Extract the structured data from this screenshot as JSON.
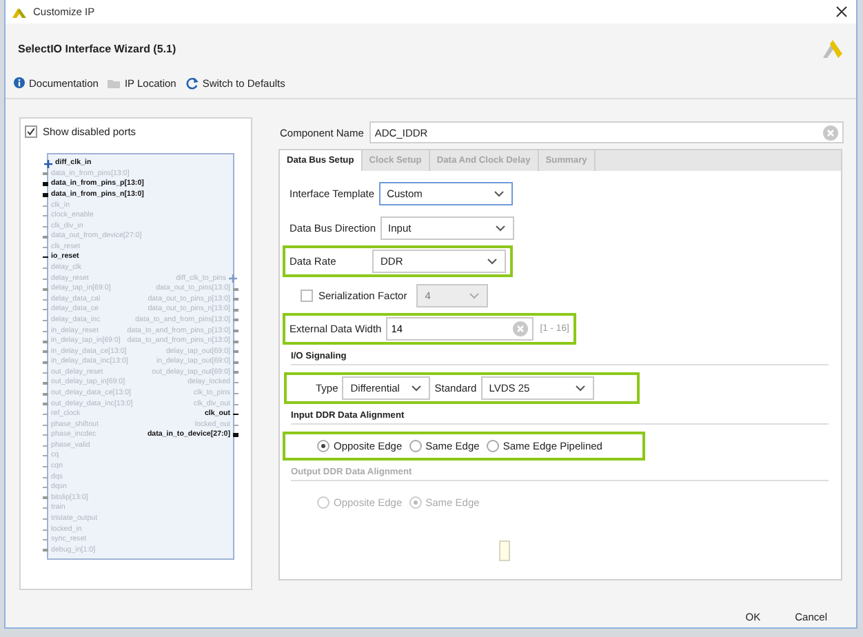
{
  "window": {
    "title": "Customize IP"
  },
  "header": {
    "title": "SelectIO Interface Wizard (5.1)"
  },
  "toolbar": [
    {
      "label": "Documentation",
      "kind": "info"
    },
    {
      "label": "IP Location",
      "kind": "folder"
    },
    {
      "label": "Switch to Defaults",
      "kind": "refresh"
    }
  ],
  "symbol_panel": {
    "show_disabled_ports": {
      "label": "Show disabled ports",
      "checked": true
    },
    "left_ports": [
      {
        "name": "diff_clk_in",
        "kind": "diff",
        "enabled": true
      },
      {
        "name": "data_in_from_pins[13:0]",
        "kind": "bus",
        "enabled": false
      },
      {
        "name": "data_in_from_pins_p[13:0]",
        "kind": "bus",
        "enabled": true
      },
      {
        "name": "data_in_from_pins_n[13:0]",
        "kind": "bus",
        "enabled": true
      },
      {
        "name": "clk_in",
        "kind": "single",
        "enabled": false
      },
      {
        "name": "clock_enable",
        "kind": "single",
        "enabled": false
      },
      {
        "name": "clk_div_in",
        "kind": "single",
        "enabled": false
      },
      {
        "name": "data_out_from_device[27:0]",
        "kind": "bus",
        "enabled": false
      },
      {
        "name": "clk_reset",
        "kind": "single",
        "enabled": false
      },
      {
        "name": "io_reset",
        "kind": "single",
        "enabled": true
      },
      {
        "name": "delay_clk",
        "kind": "single",
        "enabled": false
      },
      {
        "name": "delay_reset",
        "kind": "single",
        "enabled": false
      },
      {
        "name": "delay_tap_in[69:0]",
        "kind": "bus",
        "enabled": false
      },
      {
        "name": "delay_data_cal",
        "kind": "single",
        "enabled": false
      },
      {
        "name": "delay_data_ce",
        "kind": "single",
        "enabled": false
      },
      {
        "name": "delay_data_inc",
        "kind": "single",
        "enabled": false
      },
      {
        "name": "in_delay_reset",
        "kind": "single",
        "enabled": false
      },
      {
        "name": "in_delay_tap_in[69:0]",
        "kind": "bus",
        "enabled": false
      },
      {
        "name": "in_delay_data_ce[13:0]",
        "kind": "bus",
        "enabled": false
      },
      {
        "name": "in_delay_data_inc[13:0]",
        "kind": "bus",
        "enabled": false
      },
      {
        "name": "out_delay_reset",
        "kind": "single",
        "enabled": false
      },
      {
        "name": "out_delay_tap_in[69:0]",
        "kind": "bus",
        "enabled": false
      },
      {
        "name": "out_delay_data_ce[13:0]",
        "kind": "bus",
        "enabled": false
      },
      {
        "name": "out_delay_data_inc[13:0]",
        "kind": "bus",
        "enabled": false
      },
      {
        "name": "ref_clock",
        "kind": "single",
        "enabled": false
      },
      {
        "name": "phase_shiftout",
        "kind": "single",
        "enabled": false
      },
      {
        "name": "phase_incdec",
        "kind": "single",
        "enabled": false
      },
      {
        "name": "phase_valid",
        "kind": "single",
        "enabled": false
      },
      {
        "name": "cq",
        "kind": "single",
        "enabled": false
      },
      {
        "name": "cqn",
        "kind": "single",
        "enabled": false
      },
      {
        "name": "dqs",
        "kind": "single",
        "enabled": false
      },
      {
        "name": "dqsn",
        "kind": "single",
        "enabled": false
      },
      {
        "name": "bitslip[13:0]",
        "kind": "bus",
        "enabled": false
      },
      {
        "name": "train",
        "kind": "single",
        "enabled": false
      },
      {
        "name": "tristate_output",
        "kind": "single",
        "enabled": false
      },
      {
        "name": "locked_in",
        "kind": "single",
        "enabled": false
      },
      {
        "name": "sync_reset",
        "kind": "single",
        "enabled": false
      },
      {
        "name": "debug_in[1:0]",
        "kind": "bus",
        "enabled": false
      }
    ],
    "right_ports": [
      {
        "name": "diff_clk_to_pins",
        "kind": "diff",
        "enabled": false
      },
      {
        "name": "data_out_to_pins[13:0]",
        "kind": "bus",
        "enabled": false
      },
      {
        "name": "data_out_to_pins_p[13:0]",
        "kind": "bus",
        "enabled": false
      },
      {
        "name": "data_out_to_pins_n[13:0]",
        "kind": "bus",
        "enabled": false
      },
      {
        "name": "data_to_and_from_pins[13:0]",
        "kind": "bus",
        "enabled": false
      },
      {
        "name": "data_to_and_from_pins_p[13:0]",
        "kind": "bus",
        "enabled": false
      },
      {
        "name": "data_to_and_from_pins_n[13:0]",
        "kind": "bus",
        "enabled": false
      },
      {
        "name": "delay_tap_out[69:0]",
        "kind": "bus",
        "enabled": false
      },
      {
        "name": "in_delay_tap_out[69:0]",
        "kind": "bus",
        "enabled": false
      },
      {
        "name": "out_delay_tap_out[69:0]",
        "kind": "bus",
        "enabled": false
      },
      {
        "name": "delay_locked",
        "kind": "single",
        "enabled": false
      },
      {
        "name": "clk_to_pins",
        "kind": "single",
        "enabled": false
      },
      {
        "name": "clk_div_out",
        "kind": "single",
        "enabled": false
      },
      {
        "name": "clk_out",
        "kind": "single",
        "enabled": true
      },
      {
        "name": "locked_out",
        "kind": "single",
        "enabled": false
      },
      {
        "name": "data_in_to_device[27:0]",
        "kind": "bus",
        "enabled": true
      }
    ]
  },
  "component_name": {
    "label": "Component Name",
    "value": "ADC_IDDR"
  },
  "tabs": [
    {
      "label": "Data Bus Setup",
      "selected": true
    },
    {
      "label": "Clock Setup",
      "selected": false
    },
    {
      "label": "Data And Clock Delay",
      "selected": false
    },
    {
      "label": "Summary",
      "selected": false
    }
  ],
  "fields": [
    {
      "kind": "combo",
      "label": "Interface Template",
      "value": "Custom",
      "focused": true,
      "highlighted": false
    },
    {
      "kind": "combo",
      "label": "Data Bus Direction",
      "value": "Input",
      "focused": false,
      "highlighted": false
    },
    {
      "kind": "combo",
      "label": "Data Rate",
      "value": "DDR",
      "focused": false,
      "highlighted": true
    },
    {
      "kind": "check-combo",
      "label": "Serialization Factor",
      "value": "4",
      "checked": false,
      "disabled": true,
      "highlighted": false
    },
    {
      "kind": "number",
      "label": "External Data Width",
      "value": "14",
      "range": "[1 - 16]",
      "highlighted": true
    }
  ],
  "io_signaling": {
    "title": "I/O Signaling",
    "highlighted": true,
    "type": {
      "label": "Type",
      "value": "Differential"
    },
    "standard": {
      "label": "Standard",
      "value": "LVDS 25"
    }
  },
  "alignments": [
    {
      "title": "Input DDR Data Alignment",
      "disabled": false,
      "highlighted": true,
      "options": [
        {
          "label": "Opposite Edge",
          "selected": true
        },
        {
          "label": "Same Edge",
          "selected": false
        },
        {
          "label": "Same Edge Pipelined",
          "selected": false
        }
      ]
    },
    {
      "title": "Output DDR Data Alignment",
      "disabled": true,
      "highlighted": false,
      "options": [
        {
          "label": "Opposite Edge",
          "selected": false
        },
        {
          "label": "Same Edge",
          "selected": true
        }
      ]
    }
  ],
  "buttons": [
    {
      "label": "OK"
    },
    {
      "label": "Cancel"
    }
  ]
}
